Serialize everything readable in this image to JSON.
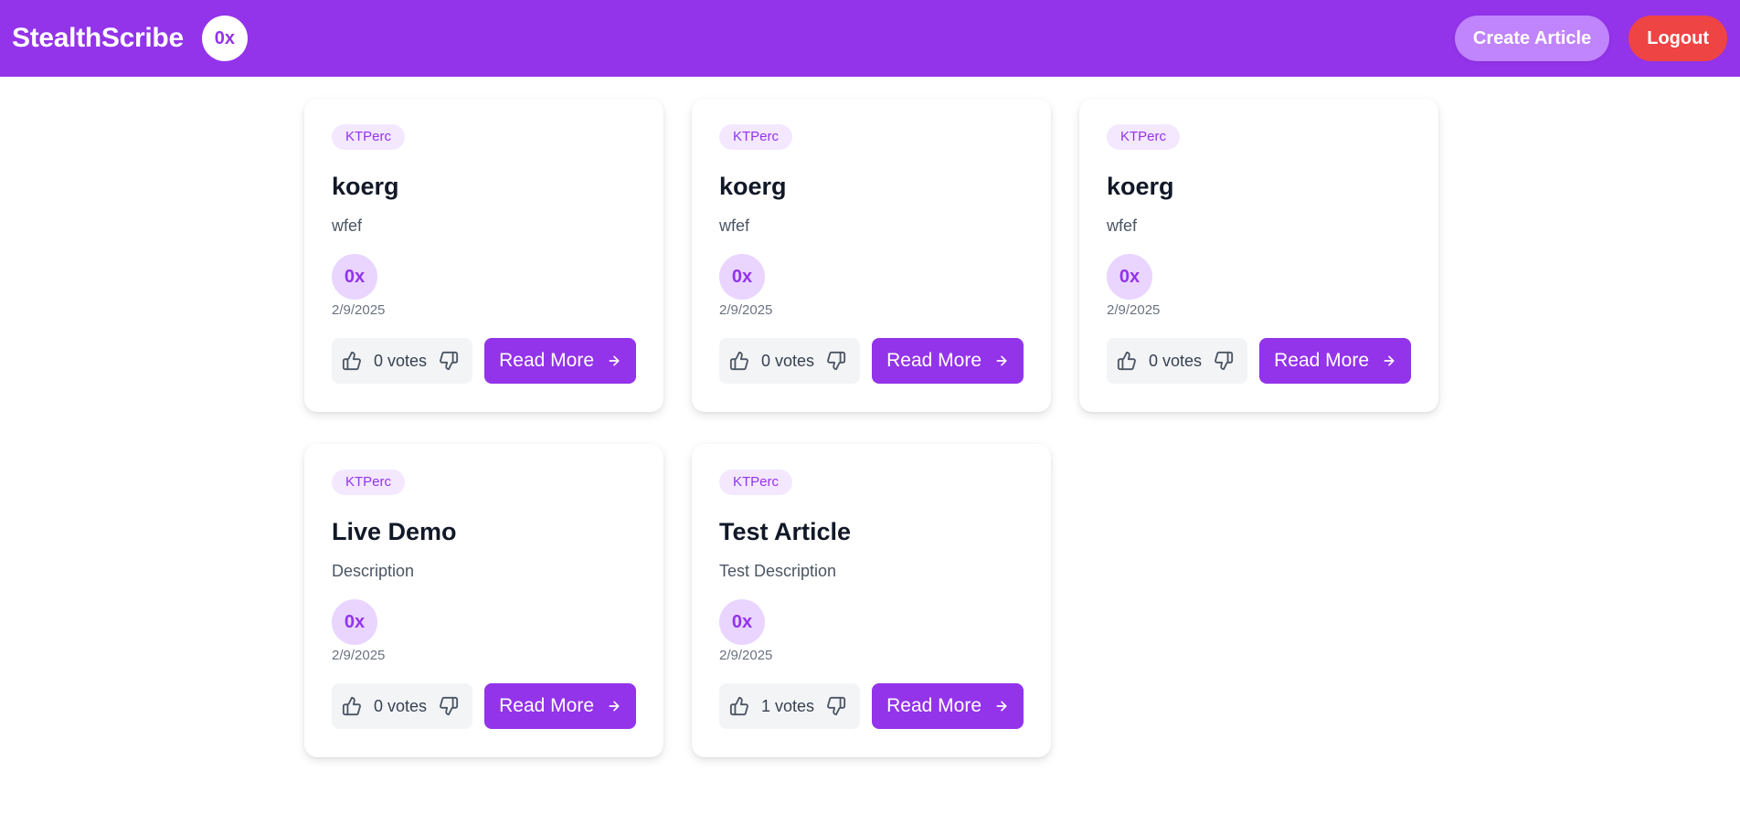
{
  "header": {
    "brand": "StealthScribe",
    "avatar_label": "0x",
    "create_label": "Create Article",
    "logout_label": "Logout"
  },
  "colors": {
    "brand_purple": "#9333ea",
    "create_button": "#c084fc",
    "logout_button": "#ef4444",
    "tag_bg": "#f3e8ff",
    "avatar_bg": "#e9d5ff"
  },
  "icons": {
    "upvote": "thumbs-up-icon",
    "downvote": "thumbs-down-icon",
    "read_more": "arrow-right-icon"
  },
  "articles": [
    {
      "tag": "KTPerc",
      "title": "koerg",
      "description": "wfef",
      "author": "0x",
      "date": "2/9/2025",
      "votes": "0 votes",
      "read_more": "Read More"
    },
    {
      "tag": "KTPerc",
      "title": "koerg",
      "description": "wfef",
      "author": "0x",
      "date": "2/9/2025",
      "votes": "0 votes",
      "read_more": "Read More"
    },
    {
      "tag": "KTPerc",
      "title": "koerg",
      "description": "wfef",
      "author": "0x",
      "date": "2/9/2025",
      "votes": "0 votes",
      "read_more": "Read More"
    },
    {
      "tag": "KTPerc",
      "title": "Live Demo",
      "description": "Description",
      "author": "0x",
      "date": "2/9/2025",
      "votes": "0 votes",
      "read_more": "Read More"
    },
    {
      "tag": "KTPerc",
      "title": "Test Article",
      "description": "Test Description",
      "author": "0x",
      "date": "2/9/2025",
      "votes": "1 votes",
      "read_more": "Read More"
    }
  ]
}
